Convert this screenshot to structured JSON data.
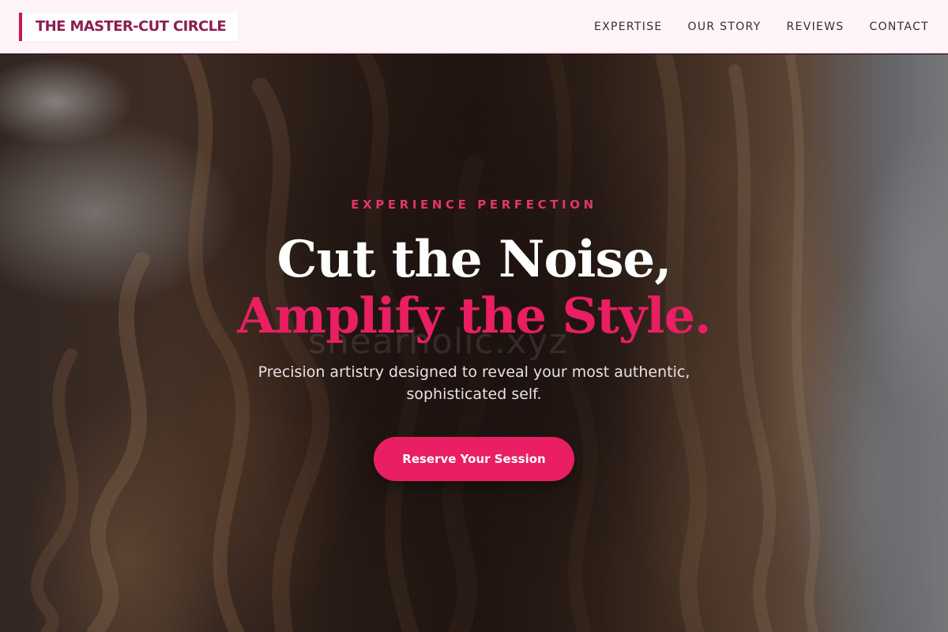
{
  "header": {
    "logo_text": "THE MASTER-CUT CIRCLE",
    "nav": [
      {
        "label": "EXPERTISE"
      },
      {
        "label": "OUR STORY"
      },
      {
        "label": "REVIEWS"
      },
      {
        "label": "CONTACT"
      }
    ]
  },
  "hero": {
    "eyebrow": "EXPERIENCE PERFECTION",
    "headline_line1": "Cut the Noise,",
    "headline_line2": "Amplify the Style.",
    "watermark": "shearholic.xyz",
    "subtext": "Precision artistry designed to reveal your most authentic, sophisticated self.",
    "cta_label": "Reserve Your Session",
    "background_image": "woman-long-wavy-hair-photo"
  },
  "colors": {
    "accent": "#e91e63",
    "logo_text": "#8e1d54",
    "logo_bar": "#c2185b",
    "header_bg": "#fff4f8",
    "nav_text": "#3a2a30"
  }
}
